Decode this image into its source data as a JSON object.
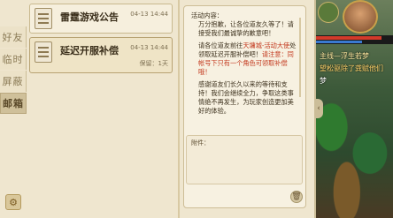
{
  "tabs": [
    {
      "label": "好友",
      "active": false
    },
    {
      "label": "临时",
      "active": false
    },
    {
      "label": "屏蔽",
      "active": false
    },
    {
      "label": "邮箱",
      "active": true
    }
  ],
  "mails": [
    {
      "title": "雷霆游戏公告",
      "time": "04-13 14:44",
      "meta": ""
    },
    {
      "title": "延迟开服补偿",
      "time": "04-13 14:44",
      "meta": "保留：1天"
    }
  ],
  "content": {
    "heading": "活动内容：",
    "para1": "万分抱歉，让各位道友久等了！请接受我们最诚挚的歉意吧！",
    "para2_a": "请各位道友前往",
    "para2_hl1": "天墉城-活动大使",
    "para2_b": "处领取延迟开服补偿吧！",
    "para2_hl2": "请注意：同帐号下只有一个角色可领取补偿哦！",
    "para3": "感谢道友们长久以来的等待和支持！我们会继续全力，争取这类事情绝不再发生，为玩家创造更加美好的体验。",
    "attachment_label": "附件："
  },
  "game": {
    "line1": "主线—浮生若梦",
    "line2": "望松驱除了龚赋他们",
    "line3": "梦",
    "hp_fraction": 0.85,
    "mp_fraction": 0.6
  },
  "colors": {
    "panel": "#efe6cf",
    "highlight": "#c3391e"
  }
}
